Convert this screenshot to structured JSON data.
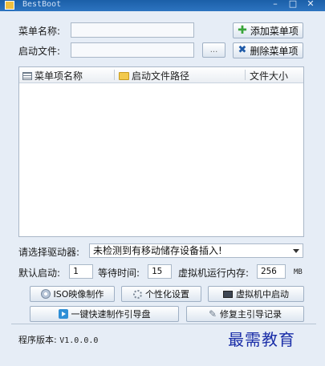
{
  "window": {
    "title": "BestBoot",
    "minimize": "–",
    "maximize": "□",
    "close": "✕"
  },
  "form": {
    "menu_name_label": "菜单名称:",
    "menu_name_value": "",
    "boot_file_label": "启动文件:",
    "boot_file_value": "",
    "browse_label": "...",
    "add_menu_label": "添加菜单项",
    "delete_menu_label": "删除菜单项"
  },
  "list": {
    "columns": [
      "菜单项名称",
      "启动文件路径",
      "文件大小"
    ],
    "rows": []
  },
  "drive": {
    "label": "请选择驱动器:",
    "selected": "未检测到有移动储存设备插入!"
  },
  "settings": {
    "default_boot_label": "默认启动:",
    "default_boot_value": "1",
    "wait_time_label": "等待时间:",
    "wait_time_value": "15",
    "vm_memory_label": "虚拟机运行内存:",
    "vm_memory_value": "256",
    "vm_memory_unit": "MB"
  },
  "actions": {
    "iso_label": "ISO映像制作",
    "personalize_label": "个性化设置",
    "vm_boot_label": "虚拟机中启动",
    "one_click_label": "一键快速制作引导盘",
    "repair_label": "修复主引导记录"
  },
  "footer": {
    "version_label": "程序版本:",
    "version_value": "V1.0.0.0",
    "watermark": "最需教育"
  },
  "colors": {
    "window_bg": "#e6edf6",
    "titlebar": "#2d74c0",
    "watermark": "#1a2ea8"
  }
}
